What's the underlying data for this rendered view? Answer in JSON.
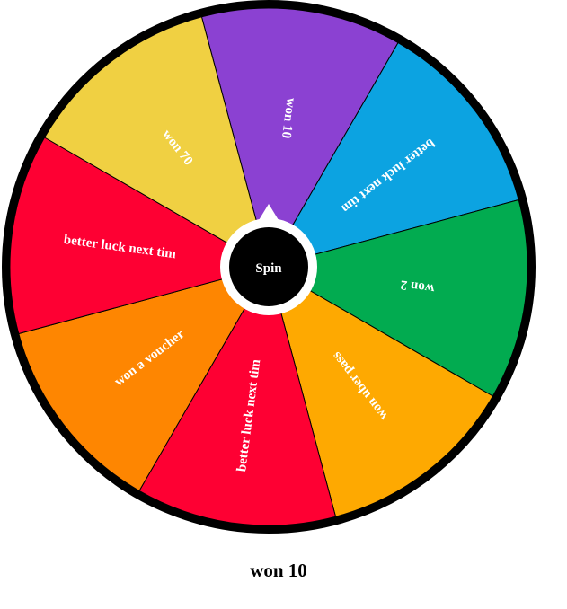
{
  "wheel": {
    "segments": [
      {
        "label": "won 10",
        "color": "#8b41d2"
      },
      {
        "label": "better luck next tim",
        "color": "#0ca3e1"
      },
      {
        "label": "won 2",
        "color": "#02ab50"
      },
      {
        "label": "won uber pass",
        "color": "#fea901"
      },
      {
        "label": "better luck next tim",
        "color": "#fe0033"
      },
      {
        "label": "won a voucher",
        "color": "#fe8601"
      },
      {
        "label": "better luck next tim",
        "color": "#fe0033"
      },
      {
        "label": "won 70",
        "color": "#f0d042"
      }
    ],
    "rim_color": "#000000"
  },
  "spin_button": {
    "label": "Spin",
    "color": "#000000",
    "ring_color": "#ffffff"
  },
  "result": {
    "text": "won 10"
  }
}
